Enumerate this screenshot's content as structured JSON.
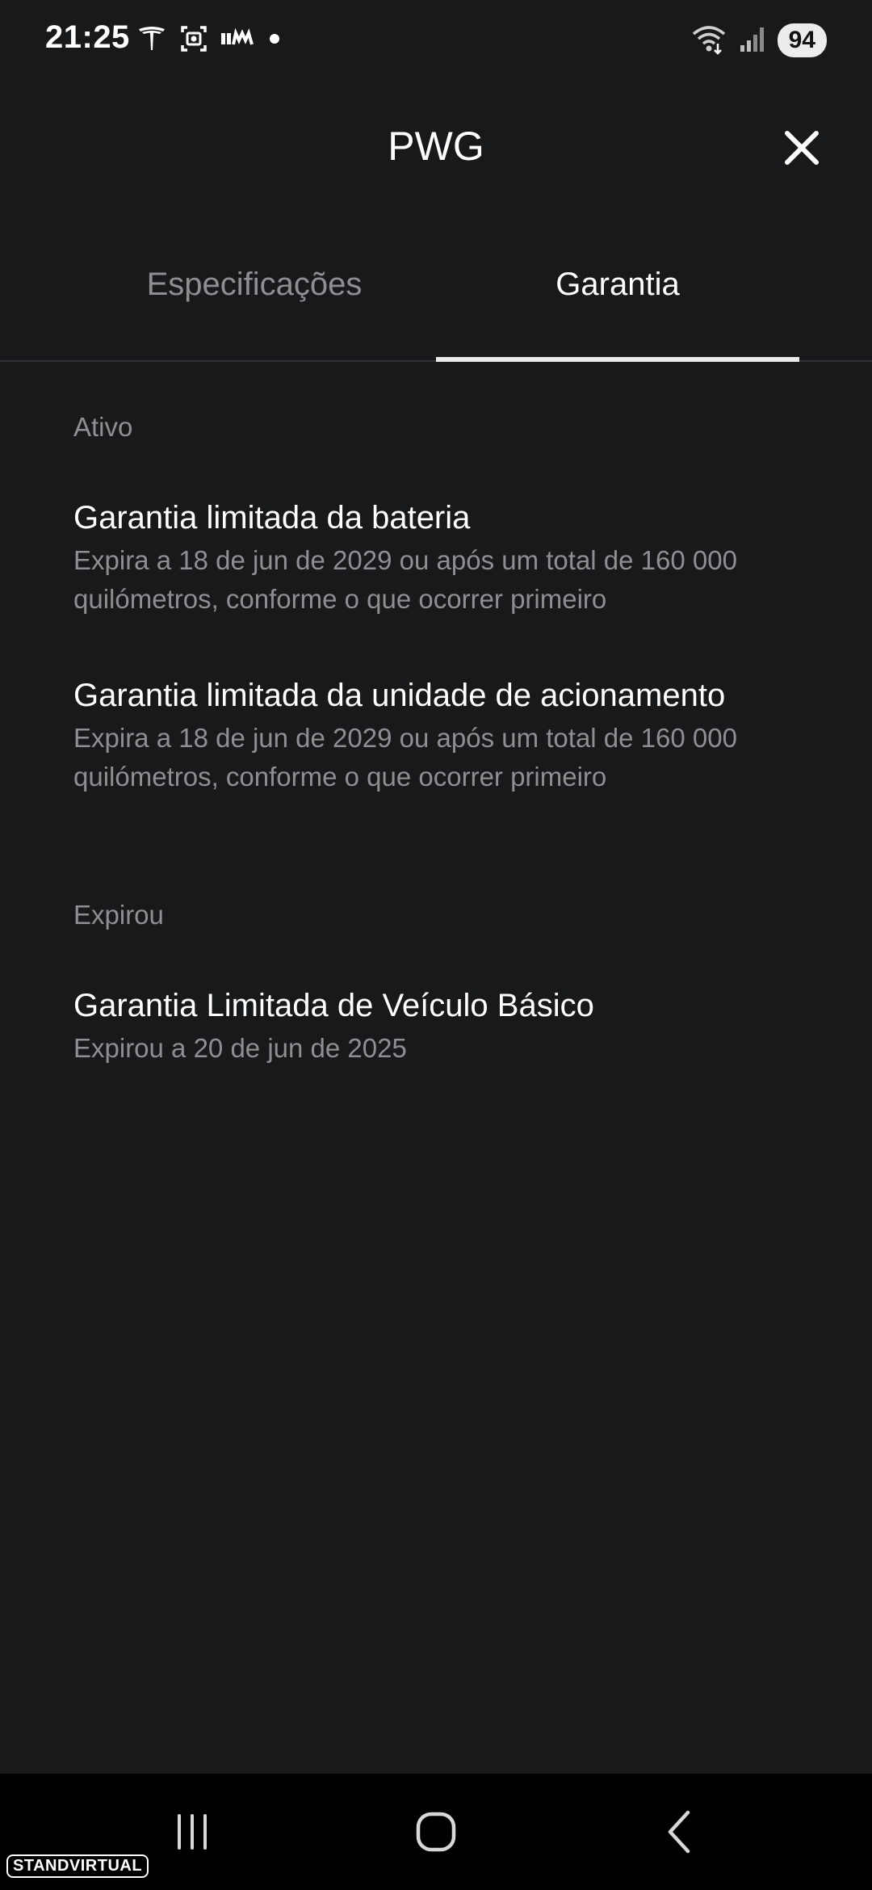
{
  "status_bar": {
    "time": "21:25",
    "battery": "94",
    "icons_left": [
      "tesla-logo-icon",
      "screenshot-icon",
      "signal-text-icon",
      "dot-icon"
    ],
    "icons_right": [
      "wifi-icon",
      "cellular-icon",
      "battery-icon"
    ]
  },
  "header": {
    "title": "PWG",
    "close_icon": "close-icon"
  },
  "tabs": [
    {
      "label": "Especificações",
      "active": false
    },
    {
      "label": "Garantia",
      "active": true
    }
  ],
  "sections": {
    "active": {
      "label": "Ativo",
      "items": [
        {
          "title": "Garantia limitada da bateria",
          "description": "Expira a 18 de jun de 2029 ou após um total de 160 000 quilómetros, conforme o que ocorrer primeiro"
        },
        {
          "title": "Garantia limitada da unidade de acionamento",
          "description": "Expira a 18 de jun de 2029 ou após um total de 160 000 quilómetros, conforme o que ocorrer primeiro"
        }
      ]
    },
    "expired": {
      "label": "Expirou",
      "items": [
        {
          "title": "Garantia Limitada de Veículo Básico",
          "description": "Expirou a 20 de jun de 2025"
        }
      ]
    }
  },
  "nav_bar": {
    "icons": [
      "recent-apps-icon",
      "home-icon",
      "back-icon"
    ]
  },
  "watermark": "STANDVIRTUAL",
  "colors": {
    "background": "#18191b",
    "primary_text": "#ffffff",
    "secondary_text": "#8e8f92",
    "tab_indicator": "#e9e9e9",
    "nav_bar": "#000000"
  }
}
